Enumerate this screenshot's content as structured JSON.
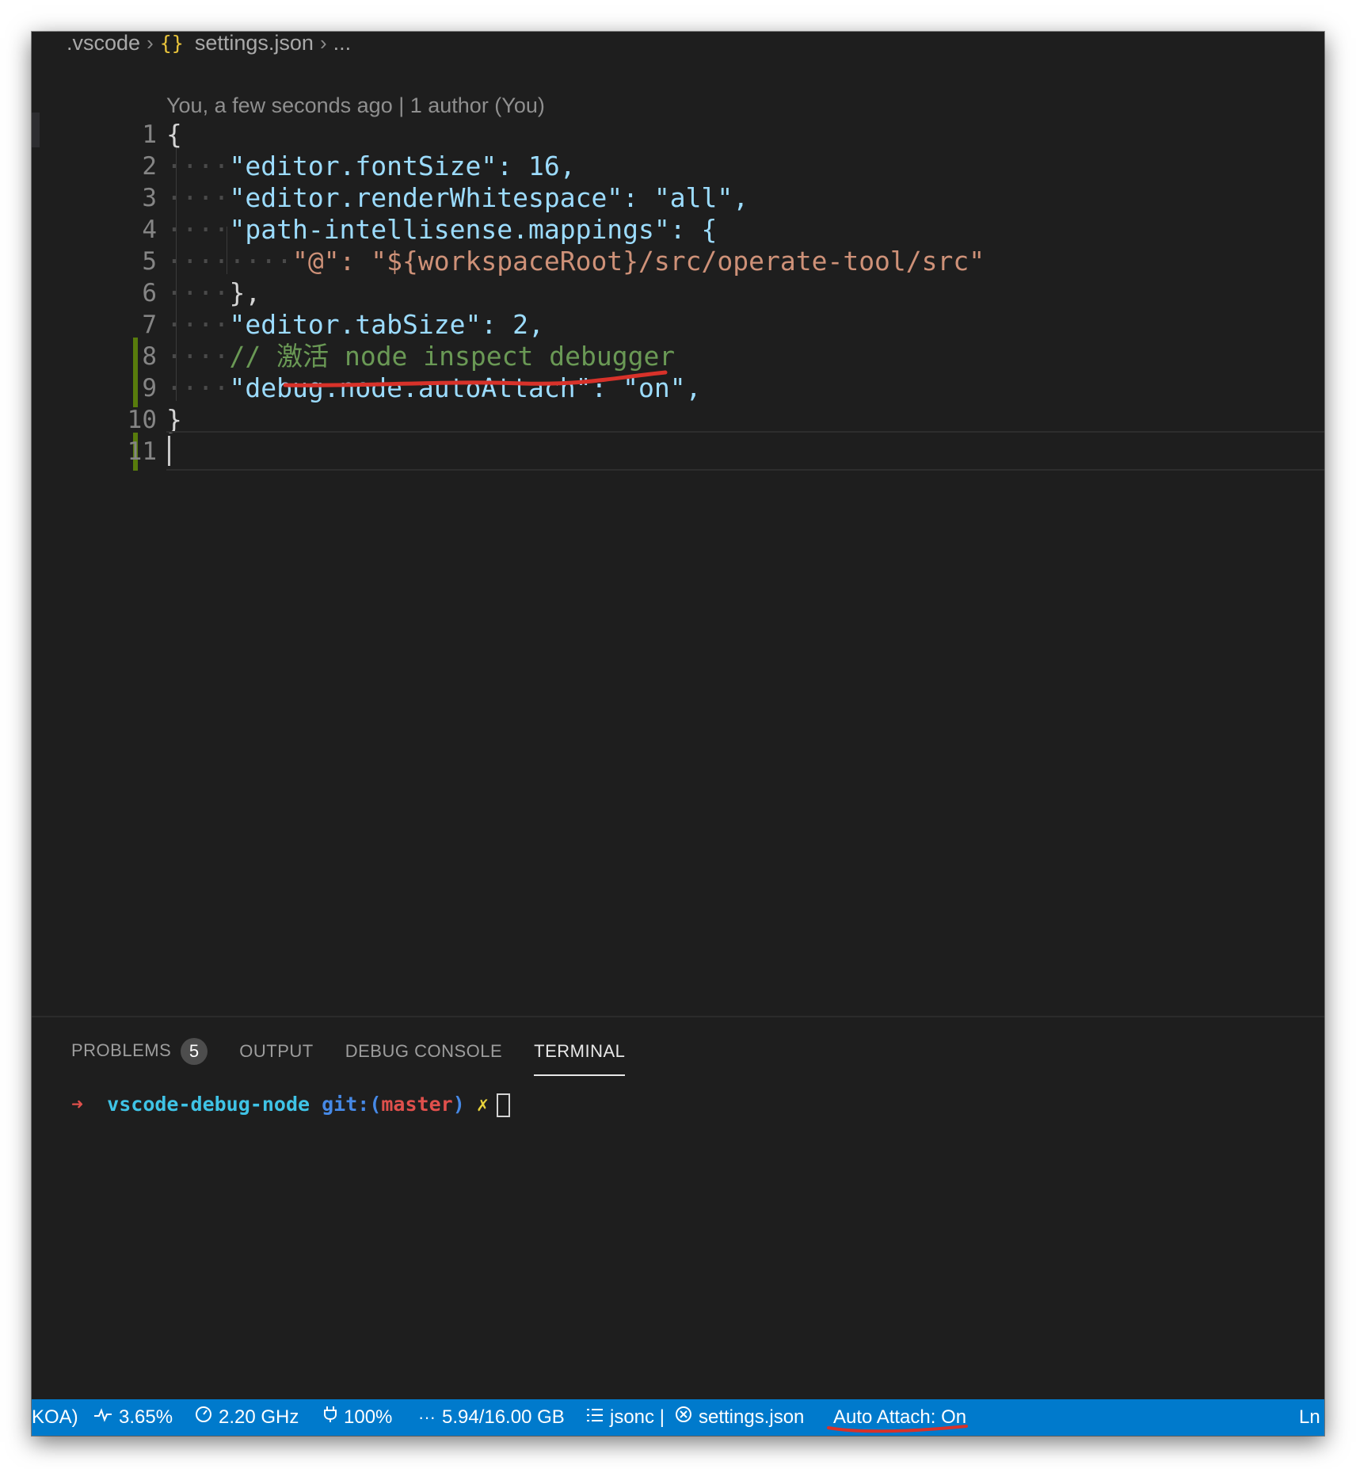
{
  "breadcrumb": {
    "folder": ".vscode",
    "json_icon": "{}",
    "file": "settings.json",
    "more": "..."
  },
  "blame": "You, a few seconds ago | 1 author (You)",
  "editor": {
    "lines": [
      {
        "n": "1",
        "text": "{"
      },
      {
        "n": "2",
        "text": "\"editor.fontSize\": 16,"
      },
      {
        "n": "3",
        "text": "\"editor.renderWhitespace\": \"all\","
      },
      {
        "n": "4",
        "text": "\"path-intellisense.mappings\": {"
      },
      {
        "n": "5",
        "text": "\"@\": \"${workspaceRoot}/src/operate-tool/src\""
      },
      {
        "n": "6",
        "text": "},"
      },
      {
        "n": "7",
        "text": "\"editor.tabSize\": 2,"
      },
      {
        "n": "8",
        "text": "// 激活 node inspect debugger"
      },
      {
        "n": "9",
        "text": "\"debug.node.autoAttach\": \"on\","
      },
      {
        "n": "10",
        "text": "}"
      },
      {
        "n": "11",
        "text": ""
      }
    ]
  },
  "panel": {
    "tabs": [
      {
        "label": "PROBLEMS",
        "badge": "5",
        "active": false
      },
      {
        "label": "OUTPUT",
        "active": false
      },
      {
        "label": "DEBUG CONSOLE",
        "active": false
      },
      {
        "label": "TERMINAL",
        "active": true
      }
    ],
    "terminal": {
      "arrow": "➜",
      "dir": "vscode-debug-node",
      "git_prefix": "git:(",
      "branch": "master",
      "git_suffix": ")",
      "dirty": "✗"
    }
  },
  "statusbar": {
    "items": {
      "koa": "KOA)",
      "cpu": "3.65%",
      "freq": "2.20 GHz",
      "battery": "100%",
      "memory": "5.94/16.00 GB",
      "language": "jsonc |",
      "schema": "settings.json",
      "auto_attach": "Auto Attach: On",
      "ln": "Ln"
    },
    "icons": {
      "cpu": "pulse-icon",
      "freq": "gauge-icon",
      "battery": "plug-icon",
      "memory": "ellipsis-icon",
      "language": "list-icon",
      "schema": "close-circle-icon"
    }
  },
  "colors": {
    "statusbar": "#007acc",
    "annotation": "#d8322a",
    "modified_gutter": "#587c0c"
  }
}
